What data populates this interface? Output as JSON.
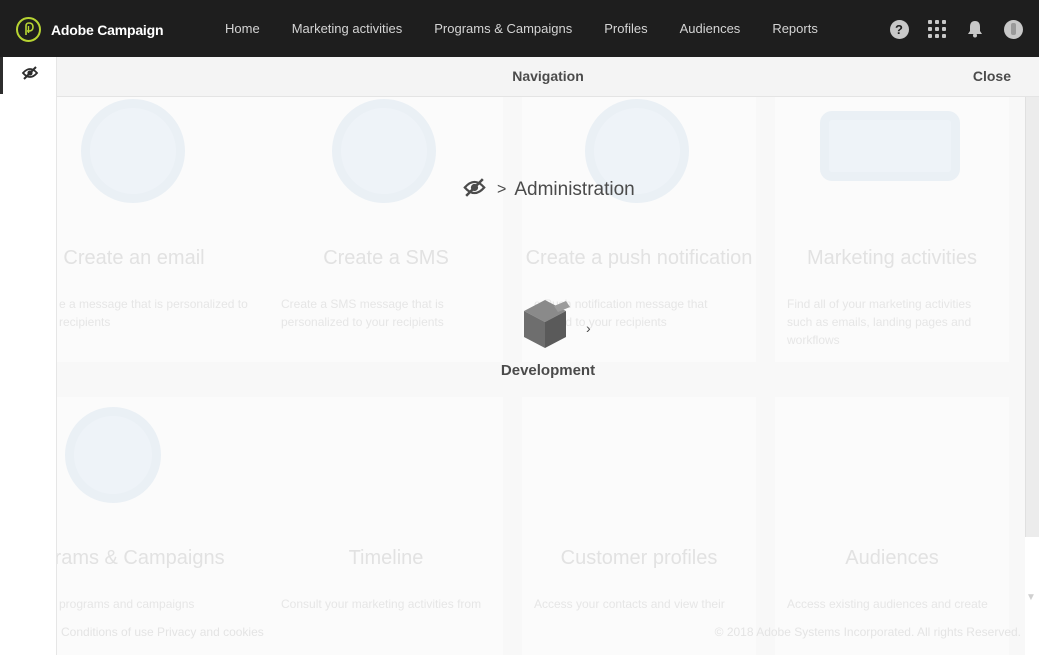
{
  "app": {
    "name": "Adobe Campaign"
  },
  "topnav": {
    "items": [
      {
        "label": "Home"
      },
      {
        "label": "Marketing activities"
      },
      {
        "label": "Programs & Campaigns"
      },
      {
        "label": "Profiles"
      },
      {
        "label": "Audiences"
      },
      {
        "label": "Reports"
      }
    ],
    "icons": [
      "help-icon",
      "apps-grid-icon",
      "bell-icon",
      "avatar"
    ]
  },
  "panel": {
    "title": "Navigation",
    "close_label": "Close",
    "breadcrumb": {
      "separator": ">",
      "current": "Administration"
    },
    "item": {
      "label": "Development",
      "chevron": "›"
    }
  },
  "background": {
    "cards": [
      {
        "title": "Create an email",
        "desc": "e a message that is personalized to recipients"
      },
      {
        "title": "Create a SMS",
        "desc": "Create a SMS message that is personalized to your recipients"
      },
      {
        "title": "Create a push notification",
        "desc": "e Push notification message that nalized to your recipients"
      },
      {
        "title": "Marketing activities",
        "desc": "Find all of your marketing activities such as emails, landing pages and workflows"
      },
      {
        "title": "grams & Campaigns",
        "desc": "programs and campaigns"
      },
      {
        "title": "Timeline",
        "desc": "Consult your marketing activities from"
      },
      {
        "title": "Customer profiles",
        "desc": "Access your contacts and view their"
      },
      {
        "title": "Audiences",
        "desc": "Access existing audiences and create"
      }
    ],
    "footer_left": "Conditions of use     Privacy and cookies",
    "footer_right": "© 2018 Adobe Systems Incorporated. All rights Reserved."
  },
  "colors": {
    "topbar": "#1e1e1e",
    "brand_accent": "#b7d432",
    "text": "#4b4b4b"
  }
}
